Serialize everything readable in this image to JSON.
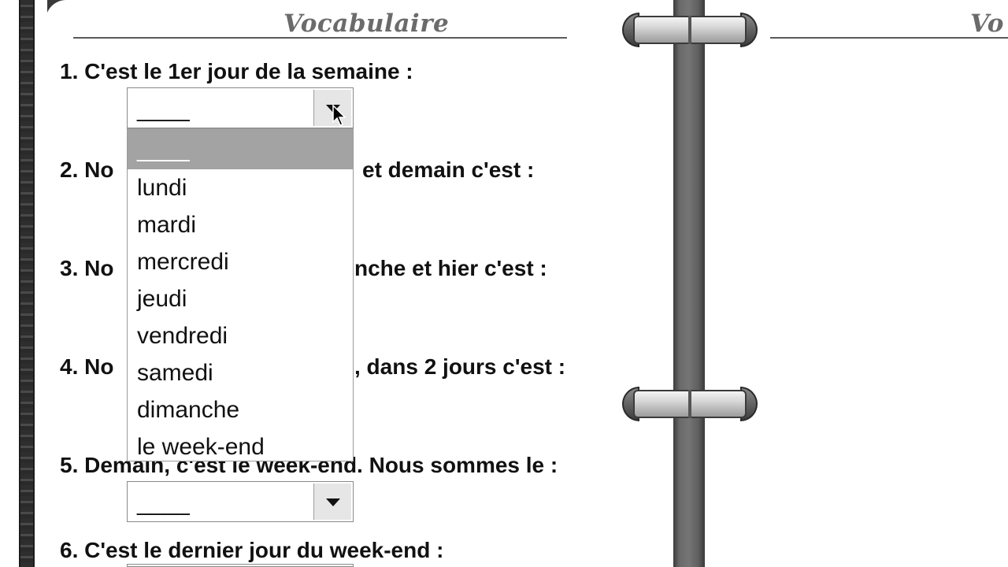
{
  "left_page": {
    "title": "Vocabulaire",
    "questions": [
      "1. C'est le 1er jour de la semaine :",
      "2. No",
      "et demain c'est :",
      "3. No",
      "nche et hier c'est :",
      "4. No",
      ", dans 2 jours c'est :",
      "5. Demain, c'est le week-end. Nous sommes le :",
      "6. C'est le dernier jour du week-end :"
    ],
    "select_placeholder": "____"
  },
  "dropdown": {
    "options": [
      "____",
      "lundi",
      "mardi",
      "mercredi",
      "jeudi",
      "vendredi",
      "samedi",
      "dimanche",
      "le week-end"
    ],
    "selected_index": 0
  },
  "right_page": {
    "title_partial": "Vo"
  },
  "colors": {
    "spine": "#6a6a6a",
    "selected_option_bg": "#a3a3a3",
    "title_color": "#6b6b6b"
  }
}
